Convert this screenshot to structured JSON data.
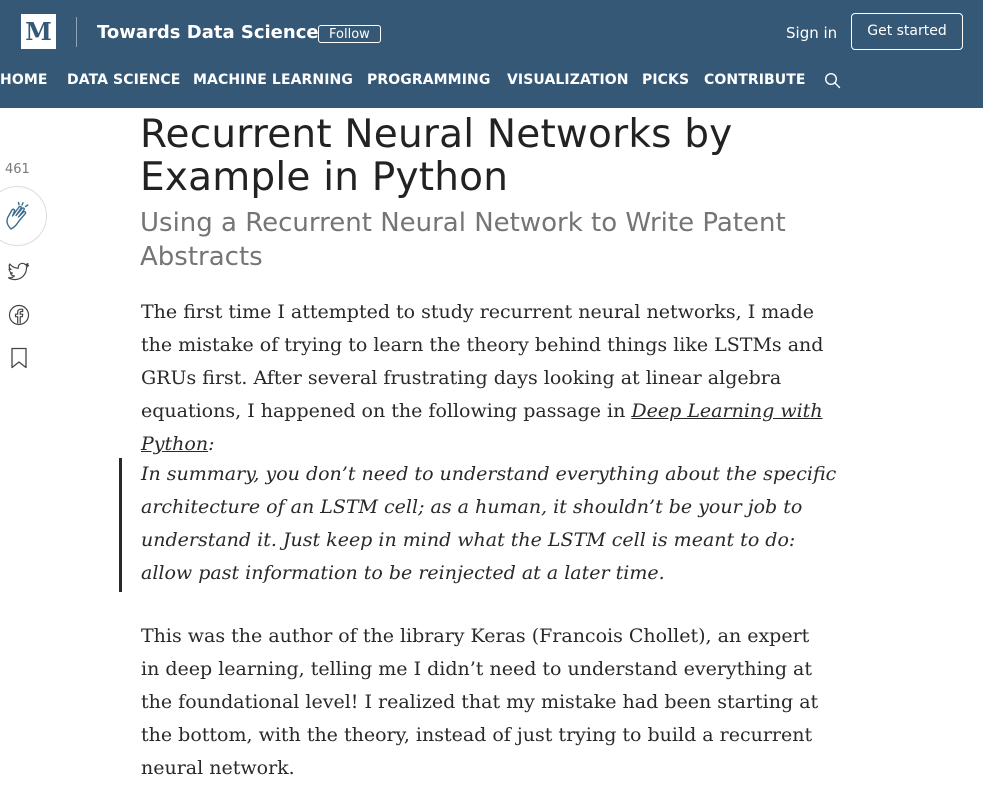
{
  "header": {
    "logo_letter": "M",
    "publication": "Towards Data Science",
    "follow_label": "Follow",
    "signin_label": "Sign in",
    "get_started_label": "Get started",
    "background_color": "#355876"
  },
  "nav": {
    "items": [
      "HOME",
      "DATA SCIENCE",
      "MACHINE LEARNING",
      "PROGRAMMING",
      "VISUALIZATION",
      "PICKS",
      "CONTRIBUTE"
    ],
    "search_icon": "search-icon"
  },
  "share_rail": {
    "clap_count": "461",
    "icons": [
      "clap-icon",
      "twitter-icon",
      "facebook-icon",
      "bookmark-icon"
    ]
  },
  "article": {
    "title": "Recurrent Neural Networks by Example in Python",
    "subtitle": "Using a Recurrent Neural Network to Write Patent Abstracts",
    "p1_text": "The first time I attempted to study recurrent neural networks, I made the mistake of trying to learn the theory behind things like LSTMs and GRUs first. After several frustrating days looking at linear algebra equations, I happened on the following passage in ",
    "p1_link": "Deep Learning with Python",
    "p1_end": ":",
    "quote": "In summary, you don’t need to understand everything about the specific architecture of an LSTM cell; as a human, it shouldn’t be your job to understand it. Just keep in mind what the LSTM cell is meant to do: allow past information to be reinjected at a later time.",
    "p2": "This was the author of the library Keras (Francois Chollet), an expert in deep learning, telling me I didn’t need to understand everything at the foundational level! I realized that my mistake had been starting at the bottom, with the theory, instead of just trying to build a recurrent neural network."
  }
}
